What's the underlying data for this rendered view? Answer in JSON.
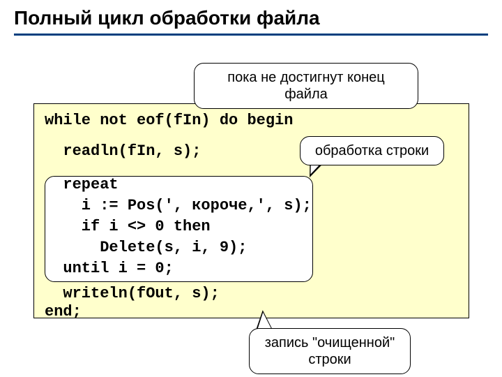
{
  "title": "Полный цикл обработки файла",
  "callouts": {
    "c1": "пока не достигнут конец файла",
    "c2": "обработка строки",
    "c3": "запись \"очищенной\" строки"
  },
  "code": {
    "l1": "while not eof(fIn) do begin",
    "l2": "  readln(fIn, s);",
    "l3": "  repeat",
    "l4": "    i := Pos(', короче,', s);",
    "l5": "    if i <> 0 then",
    "l6": "      Delete(s, i, 9);",
    "l7": "  until i = 0;",
    "l8": "  writeln(fOut, s);",
    "l9": "end;"
  }
}
